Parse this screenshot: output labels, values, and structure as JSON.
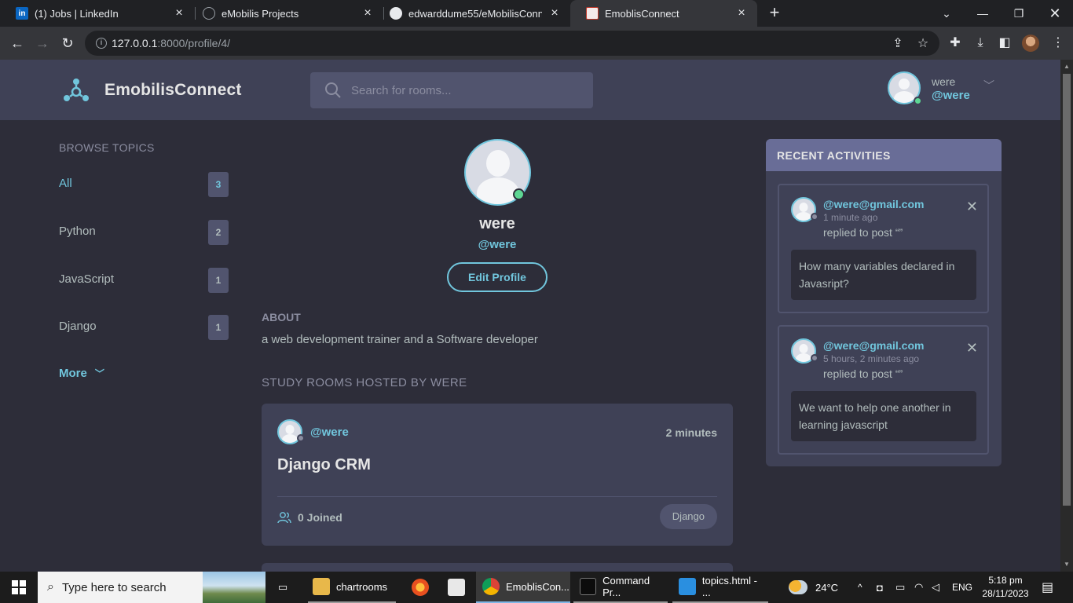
{
  "browser": {
    "tabs": [
      {
        "title": "(1) Jobs | LinkedIn",
        "icon": "linkedin-icon"
      },
      {
        "title": "eMobilis Projects",
        "icon": "globe-icon"
      },
      {
        "title": "edwarddume55/eMobilisConnect",
        "icon": "github-icon"
      },
      {
        "title": "EmoblisConnect",
        "icon": "site-favicon"
      }
    ],
    "url_host": "127.0.0.1",
    "url_path": ":8000/profile/4/"
  },
  "app": {
    "brand": "EmobilisConnect",
    "search_placeholder": "Search for rooms...",
    "user": {
      "name": "were",
      "handle": "@were"
    }
  },
  "topics": {
    "title": "BROWSE TOPICS",
    "items": [
      {
        "name": "All",
        "count": "3"
      },
      {
        "name": "Python",
        "count": "2"
      },
      {
        "name": "JavaScript",
        "count": "1"
      },
      {
        "name": "Django",
        "count": "1"
      }
    ],
    "more_label": "More"
  },
  "profile": {
    "name": "were",
    "handle": "@were",
    "edit_label": "Edit Profile",
    "about_title": "ABOUT",
    "about_text": "a web development trainer and a Software developer",
    "rooms_title": "STUDY ROOMS HOSTED BY WERE"
  },
  "rooms": [
    {
      "host": "@were",
      "time": "2 minutes",
      "title": "Django CRM",
      "joined": "0 Joined",
      "topic": "Django"
    }
  ],
  "activities": {
    "title": "RECENT ACTIVITIES",
    "items": [
      {
        "user": "@were@gmail.com",
        "time": "1 minute ago",
        "action": "replied to post “”",
        "body": "How many variables declared in Javasript?"
      },
      {
        "user": "@were@gmail.com",
        "time": "5 hours, 2 minutes ago",
        "action": "replied to post “”",
        "body": "We want to help one another in learning javascript"
      }
    ]
  },
  "taskbar": {
    "search_placeholder": "Type here to search",
    "apps": [
      {
        "label": "chartrooms"
      },
      {
        "label": "EmoblisCon..."
      },
      {
        "label": "Command Pr..."
      },
      {
        "label": "topics.html - ..."
      }
    ],
    "weather": "24°C",
    "language": "ENG",
    "time": "5:18 pm",
    "date": "28/11/2023"
  },
  "colors": {
    "accent": "#71c6dd",
    "header_bg": "#3f4156",
    "page_bg": "#2d2d39",
    "online": "#5dd693"
  }
}
